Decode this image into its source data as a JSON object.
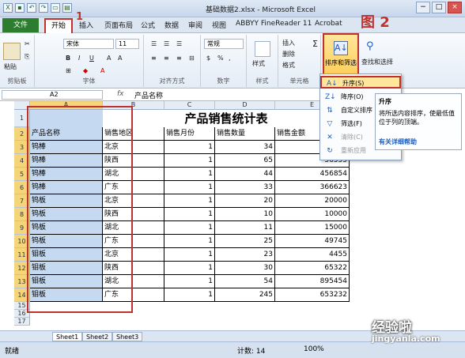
{
  "window": {
    "title": "基础数据2.xlsx - Microsoft Excel"
  },
  "tabs": {
    "file": "文件",
    "home": "开始",
    "items": [
      "插入",
      "页面布局",
      "公式",
      "数据",
      "审阅",
      "视图",
      "ABBYY FineReader 11",
      "Acrobat"
    ]
  },
  "ribbon": {
    "clipboard": {
      "label": "剪贴板",
      "paste": "粘贴"
    },
    "font": {
      "label": "字体",
      "name": "宋体",
      "size": "11",
      "bold": "B",
      "italic": "I",
      "underline": "U"
    },
    "align": {
      "label": "对齐方式"
    },
    "number": {
      "label": "数字",
      "format": "常规",
      "percent": "%",
      "comma": ","
    },
    "styles": {
      "label": "样式"
    },
    "cells": {
      "label": "单元格",
      "insert": "插入",
      "delete": "删除",
      "format": "格式"
    },
    "sort_filter": "排序和筛选",
    "find_select": "查找和选择",
    "sigma": "Σ"
  },
  "annotations": {
    "fig1": "1",
    "fig2": "图 2"
  },
  "formula": {
    "cell": "A2",
    "fx": "fx",
    "value": "产品名称"
  },
  "columns": [
    "A",
    "B",
    "C",
    "D",
    "E"
  ],
  "sheet": {
    "title": "产品销售统计表",
    "headers": [
      "产品名称",
      "销售地区",
      "销售月份",
      "销售数量",
      "销售金额"
    ],
    "rows": [
      [
        "钨棒",
        "北京",
        "1",
        "34",
        ""
      ],
      [
        "钨棒",
        "陕西",
        "1",
        "65",
        "56555"
      ],
      [
        "钨棒",
        "湖北",
        "1",
        "44",
        "456854"
      ],
      [
        "钨棒",
        "广东",
        "1",
        "33",
        "366623"
      ],
      [
        "钨板",
        "北京",
        "1",
        "20",
        "20000"
      ],
      [
        "钨板",
        "陕西",
        "1",
        "10",
        "10000"
      ],
      [
        "钨板",
        "湖北",
        "1",
        "11",
        "15000"
      ],
      [
        "钨板",
        "广东",
        "1",
        "25",
        "49745"
      ],
      [
        "钼板",
        "北京",
        "1",
        "23",
        "4455"
      ],
      [
        "钼板",
        "陕西",
        "1",
        "30",
        "65322"
      ],
      [
        "钼板",
        "湖北",
        "1",
        "54",
        "895454"
      ],
      [
        "钼板",
        "广东",
        "1",
        "245",
        "653232"
      ]
    ]
  },
  "menu": {
    "items": [
      {
        "label": "升序(S)",
        "icon": "sort-asc-icon"
      },
      {
        "label": "降序(O)",
        "icon": "sort-desc-icon"
      },
      {
        "label": "自定义排序",
        "icon": "custom-sort-icon"
      },
      {
        "label": "筛选(F)",
        "icon": "filter-icon"
      },
      {
        "label": "清除(C)",
        "icon": "clear-icon"
      },
      {
        "label": "重新应用",
        "icon": "reapply-icon"
      }
    ]
  },
  "tooltip": {
    "title": "升序",
    "body": "将所选内容排序，使最低值位于列的顶端。",
    "help": "有关详细帮助"
  },
  "sheet_tabs": [
    "Sheet1",
    "Sheet2",
    "Sheet3"
  ],
  "status": {
    "ready": "就绪",
    "count": "计数: 14",
    "zoom": "100%"
  },
  "watermark": {
    "line1": "经验啦",
    "line2": "jingyanla.com"
  }
}
